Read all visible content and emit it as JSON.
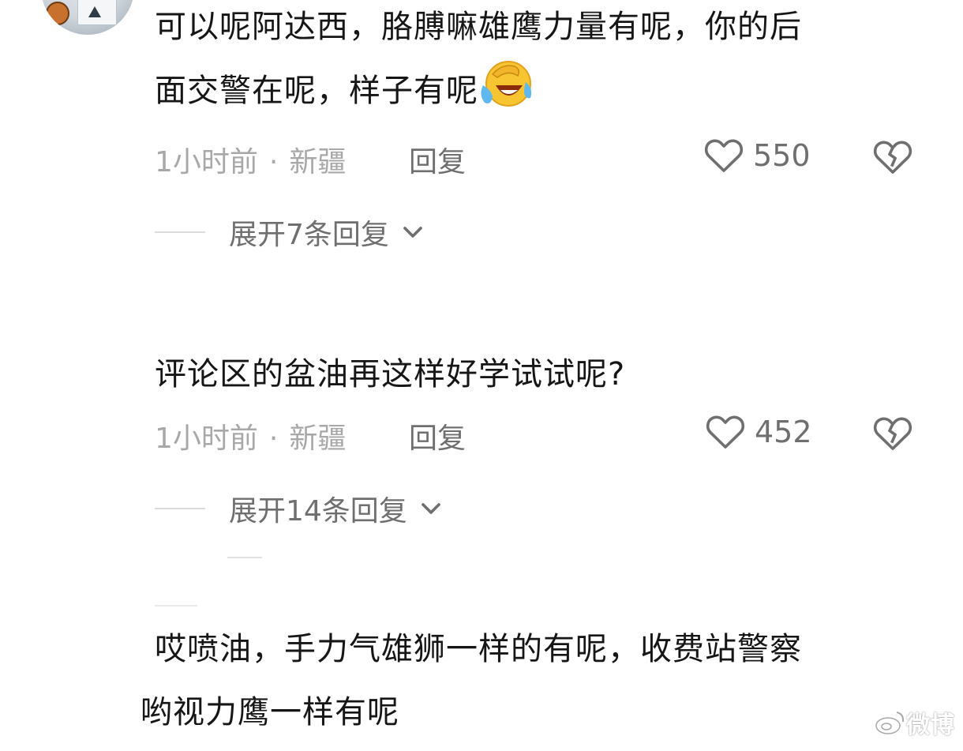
{
  "comments": [
    {
      "text_line1": "可以呢阿达西，胳膊嘛雄鹰力量有呢，你的后",
      "text_line2": "面交警在呢，样子有呢",
      "emoji": "laughing-crying-emoji",
      "time": "1小时前",
      "separator": "·",
      "location": "新疆",
      "reply_label": "回复",
      "likes": "550",
      "expand_label": "展开7条回复"
    },
    {
      "text_line1": "评论区的盆油再这样好学试试呢?",
      "time": "1小时前",
      "separator": "·",
      "location": "新疆",
      "reply_label": "回复",
      "likes": "452",
      "expand_label": "展开14条回复"
    },
    {
      "text_line1": "哎喷油，手力气雄狮一样的有呢，收费站警察",
      "text_line2": "哟视力鹰一样有呢"
    }
  ],
  "watermark": "微博",
  "icons": {
    "like": "heart-outline-icon",
    "dislike": "broken-heart-icon",
    "expand": "chevron-down-icon"
  },
  "colors": {
    "text": "#161616",
    "meta": "#a8a8a8",
    "secondary": "#6f6f6f"
  }
}
